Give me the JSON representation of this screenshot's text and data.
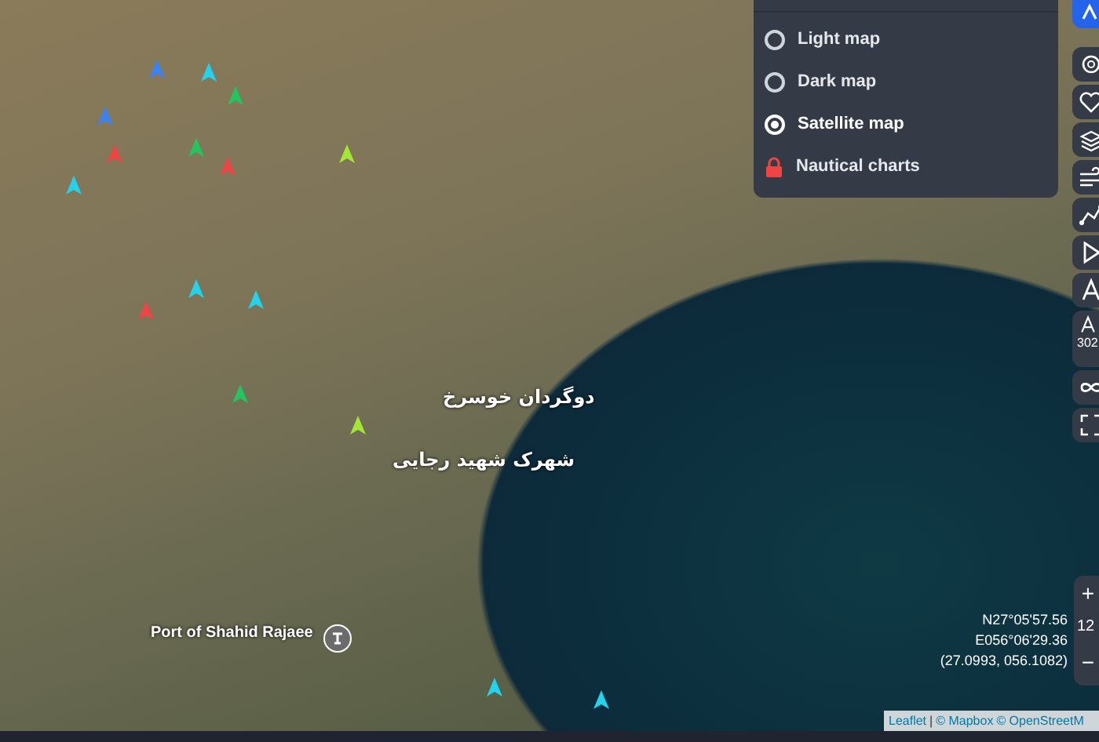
{
  "map_type_panel": {
    "options": [
      {
        "label": "Light map",
        "kind": "radio",
        "selected": false
      },
      {
        "label": "Dark map",
        "kind": "radio",
        "selected": false
      },
      {
        "label": "Satellite map",
        "kind": "radio",
        "selected": true
      },
      {
        "label": "Nautical charts",
        "kind": "locked",
        "selected": false
      }
    ]
  },
  "toolbar": {
    "buttons": [
      {
        "kind": "active"
      },
      {
        "kind": "radar"
      },
      {
        "kind": "heart"
      },
      {
        "kind": "layers"
      },
      {
        "kind": "wind"
      },
      {
        "kind": "route"
      },
      {
        "kind": "play"
      },
      {
        "kind": "text"
      }
    ],
    "reading": "302",
    "tools": [
      {
        "kind": "infinity"
      },
      {
        "kind": "fullscreen"
      }
    ]
  },
  "zoom": {
    "plus": "+",
    "level": "12",
    "minus": "−"
  },
  "map_labels": [
    {
      "text": "دوگردان خوسرخ",
      "kind": "arabic"
    },
    {
      "text": "شهرک شهید رجایی",
      "kind": "arabic"
    },
    {
      "text": "Port of Shahid Rajaee",
      "kind": "latin"
    }
  ],
  "ships": [
    {
      "color": "#22c55e"
    },
    {
      "color": "#ef4444"
    },
    {
      "color": "#3b82f6"
    },
    {
      "color": "#22d3ee"
    },
    {
      "color": "#ef4444"
    },
    {
      "color": "#22c55e"
    },
    {
      "color": "#22d3ee"
    },
    {
      "color": "#3b82f6"
    },
    {
      "color": "#a3e635"
    },
    {
      "color": "#22d3ee"
    },
    {
      "color": "#ef4444"
    },
    {
      "color": "#22c55e"
    },
    {
      "color": "#22d3ee"
    },
    {
      "color": "#22d3ee"
    },
    {
      "color": "#a3e635"
    },
    {
      "color": "#22d3ee"
    }
  ],
  "coordinates": {
    "lat": "N27°05'57.56",
    "lon": "E056°06'29.36",
    "decimal": "(27.0993, 056.1082)"
  },
  "attribution": {
    "leaflet": "Leaflet",
    "sep1": "|",
    "mapbox": "© Mapbox",
    "osm": "© OpenStreetM"
  }
}
